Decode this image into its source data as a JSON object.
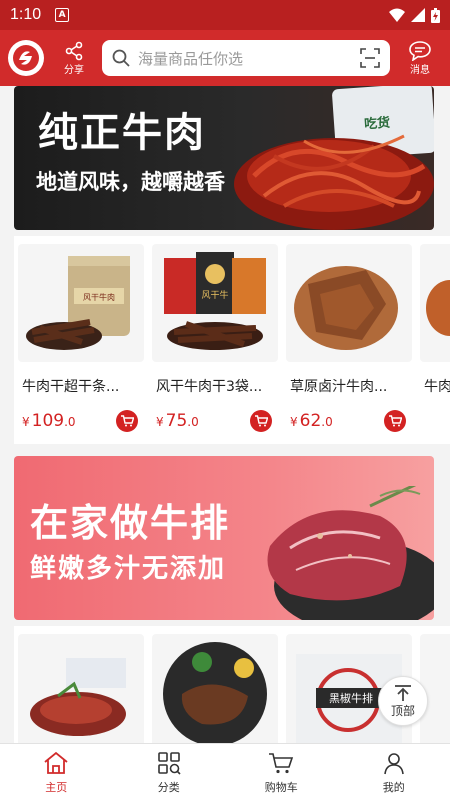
{
  "status": {
    "time": "1:10"
  },
  "header": {
    "share_label": "分享",
    "search_placeholder": "海量商品任你选",
    "message_label": "消息"
  },
  "banners": [
    {
      "title": "纯正牛肉",
      "subtitle": "地道风味，越嚼越香",
      "bag_text": "吃货"
    },
    {
      "title": "在家做牛排",
      "subtitle": "鲜嫩多汁无添加"
    }
  ],
  "products_row1": [
    {
      "name": "牛肉干超干条...",
      "price_int": "109",
      "price_dec": ".0"
    },
    {
      "name": "风干牛肉干3袋...",
      "price_int": "75",
      "price_dec": ".0"
    },
    {
      "name": "草原卤汁牛肉...",
      "price_int": "62",
      "price_dec": ".0"
    },
    {
      "name": "牛肉",
      "price_int": "",
      "price_dec": ""
    }
  ],
  "row1_img_labels": [
    "风干牛肉",
    "风干牛"
  ],
  "row2_img_labels": [
    "黑椒牛排"
  ],
  "currency": "¥",
  "back_to_top_label": "顶部",
  "tabs": [
    {
      "label": "主页",
      "icon": "home-icon",
      "active": true
    },
    {
      "label": "分类",
      "icon": "category-icon",
      "active": false
    },
    {
      "label": "购物车",
      "icon": "cart-icon",
      "active": false
    },
    {
      "label": "我的",
      "icon": "user-icon",
      "active": false
    }
  ],
  "colors": {
    "brand": "#d12b2b",
    "price": "#d32222"
  }
}
